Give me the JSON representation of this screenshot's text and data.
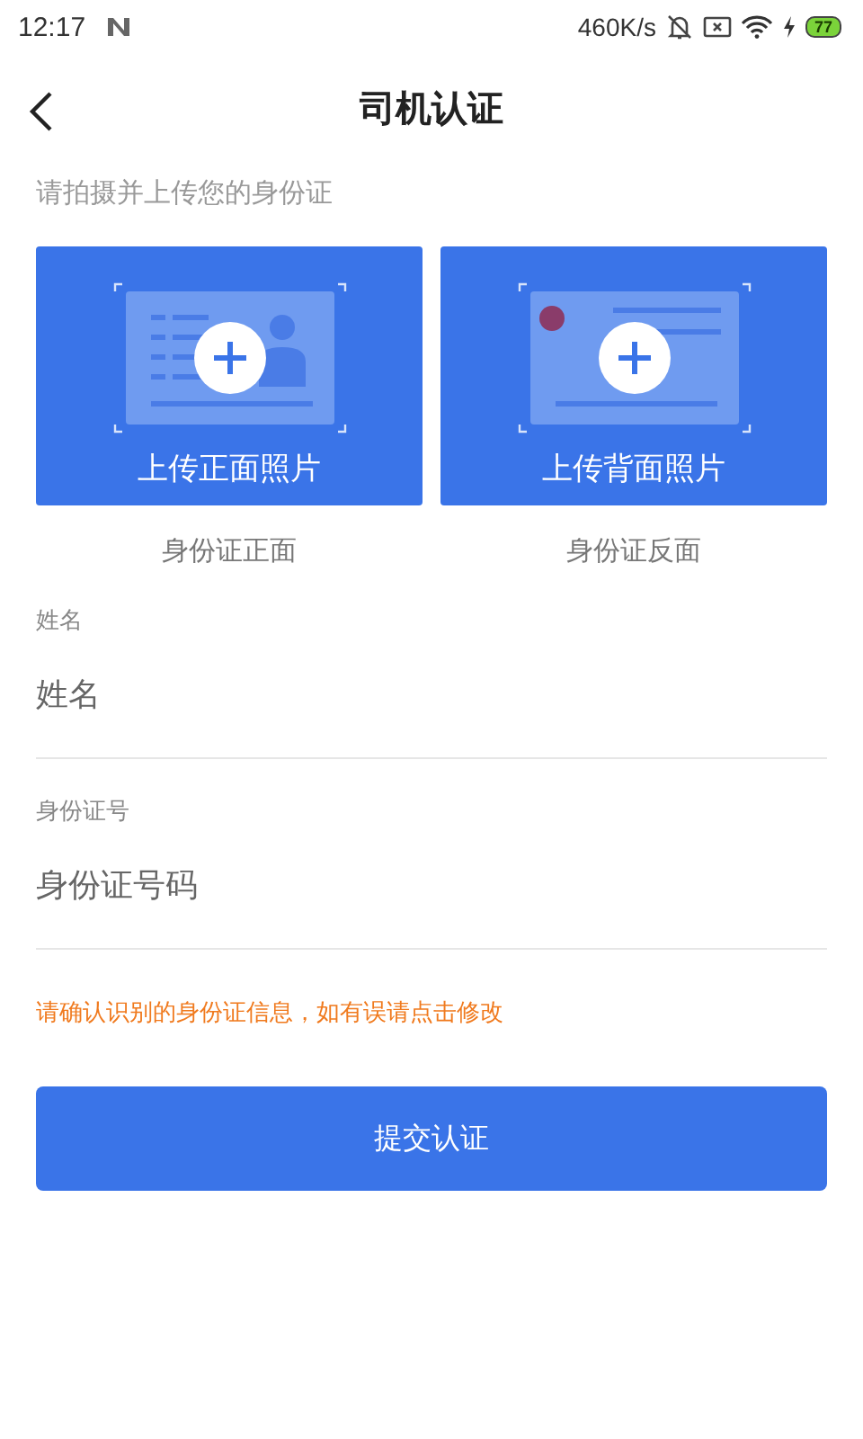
{
  "status_bar": {
    "time": "12:17",
    "speed": "460K/s",
    "battery": "77"
  },
  "header": {
    "title": "司机认证"
  },
  "prompt": "请拍摄并上传您的身份证",
  "id_cards": [
    {
      "kind": "front",
      "label": "上传正面照片",
      "caption": "身份证正面"
    },
    {
      "kind": "back",
      "label": "上传背面照片",
      "caption": "身份证反面"
    }
  ],
  "fields": [
    {
      "label": "姓名",
      "placeholder": "姓名"
    },
    {
      "label": "身份证号",
      "placeholder": "身份证号码"
    }
  ],
  "notice": "请确认识别的身份证信息，如有误请点击修改",
  "submit_button": "提交认证"
}
